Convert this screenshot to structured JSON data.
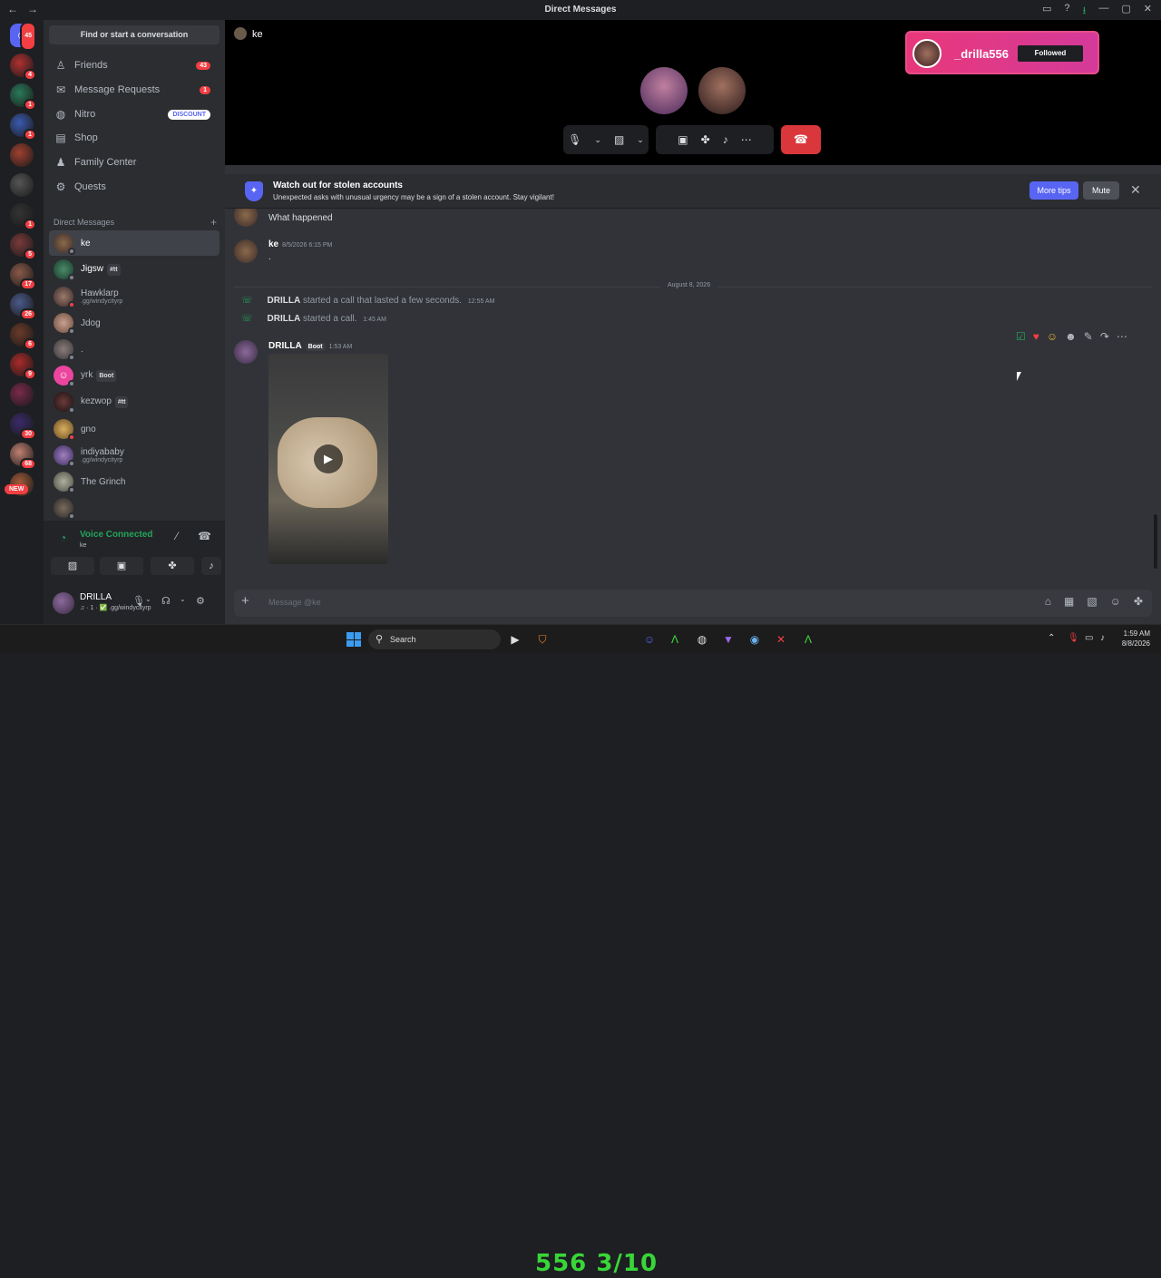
{
  "window": {
    "title": "Direct Messages"
  },
  "sidebar": {
    "find_label": "Find or start a conversation",
    "nav": [
      {
        "label": "Friends",
        "badge": "43"
      },
      {
        "label": "Message Requests",
        "badge": "1"
      },
      {
        "label": "Nitro",
        "badge": "DISCOUNT"
      },
      {
        "label": "Shop"
      },
      {
        "label": "Family Center"
      },
      {
        "label": "Quests"
      }
    ],
    "dm_header": "Direct Messages",
    "dms": [
      {
        "name": "ke",
        "sub": "",
        "tag": ""
      },
      {
        "name": "Jigsw",
        "sub": "",
        "tag": "#tt"
      },
      {
        "name": "Hawklarp",
        "sub": ".gg/windycityrp",
        "tag": ""
      },
      {
        "name": "Jdog",
        "sub": "",
        "tag": ""
      },
      {
        "name": ".",
        "sub": "",
        "tag": ""
      },
      {
        "name": "yrk",
        "sub": "",
        "tag": "Boot"
      },
      {
        "name": "kezwop",
        "sub": "",
        "tag": "#tt"
      },
      {
        "name": "gno",
        "sub": "",
        "tag": ""
      },
      {
        "name": "indiyababy",
        "sub": ".gg/windycityrp",
        "tag": ""
      },
      {
        "name": "The Grinch",
        "sub": "",
        "tag": ""
      }
    ],
    "voice": {
      "status": "Voice Connected",
      "channel": "ke"
    },
    "user": {
      "name": "DRILLA",
      "status": "♫ · 1 · ✅ .gg/windycityrp"
    }
  },
  "guild_badges": [
    "45",
    "4",
    "1",
    "1",
    "",
    "",
    "1",
    "5",
    "17",
    "26",
    "6",
    "9",
    "",
    "30",
    "68",
    ""
  ],
  "guild_new_label": "NEW",
  "call": {
    "channel": "ke"
  },
  "follow_card": {
    "name": "_drilla556",
    "button": "Followed"
  },
  "warning": {
    "title": "Watch out for stolen accounts",
    "text": "Unexpected asks with unusual urgency may be a sign of a stolen account. Stay vigilant!",
    "more_tips": "More tips",
    "mute": "Mute"
  },
  "messages": {
    "msg1_text": "What happened",
    "msg2_author": "ke",
    "msg2_time": "8/5/2026 6:15 PM",
    "msg2_text": ".",
    "date_divider": "August 8, 2026",
    "sys1_author": "DRILLA",
    "sys1_text": "started a call that lasted a few seconds.",
    "sys1_time": "12:55 AM",
    "sys2_author": "DRILLA",
    "sys2_text": "started a call.",
    "sys2_time": "1:45 AM",
    "msg3_author": "DRILLA",
    "msg3_tag": "Boot",
    "msg3_time": "1:53 AM"
  },
  "composer": {
    "placeholder": "Message @ke"
  },
  "taskbar": {
    "search": "Search",
    "overlay_text": "556 3/10",
    "time": "1:59 AM",
    "date": "8/8/2026"
  },
  "colors": {
    "accent": "#5865f2",
    "danger": "#da373c",
    "online": "#23a55a"
  }
}
